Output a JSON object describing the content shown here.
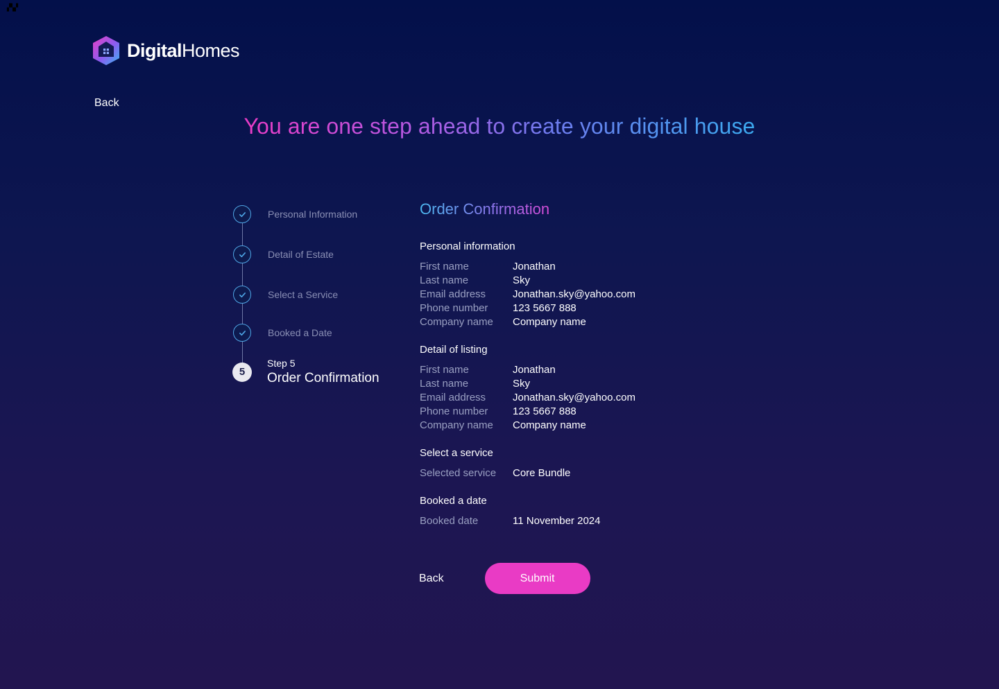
{
  "brand": {
    "name_bold": "Digital",
    "name_light": "Homes"
  },
  "nav": {
    "back_label": "Back"
  },
  "headline": "You are one step ahead to create your digital house",
  "stepper": {
    "completed_steps": [
      "Personal Information",
      "Detail of Estate",
      "Select a Service",
      "Booked a Date"
    ],
    "current": {
      "number": "5",
      "caption": "Step 5",
      "title": "Order Confirmation"
    }
  },
  "summary": {
    "title": "Order Confirmation",
    "personal": {
      "heading": "Personal information",
      "rows": [
        {
          "label": "First name",
          "value": "Jonathan"
        },
        {
          "label": "Last name",
          "value": "Sky"
        },
        {
          "label": "Email address",
          "value": "Jonathan.sky@yahoo.com"
        },
        {
          "label": "Phone number",
          "value": "123 5667 888"
        },
        {
          "label": "Company name",
          "value": "Company name"
        }
      ]
    },
    "listing": {
      "heading": "Detail of listing",
      "rows": [
        {
          "label": "First name",
          "value": "Jonathan"
        },
        {
          "label": "Last name",
          "value": "Sky"
        },
        {
          "label": "Email address",
          "value": "Jonathan.sky@yahoo.com"
        },
        {
          "label": "Phone number",
          "value": "123 5667 888"
        },
        {
          "label": "Company name",
          "value": "Company name"
        }
      ]
    },
    "service": {
      "heading": "Select a service",
      "rows": [
        {
          "label": "Selected service",
          "value": "Core Bundle"
        }
      ]
    },
    "date": {
      "heading": "Booked a date",
      "rows": [
        {
          "label": "Booked date",
          "value": "11 November 2024"
        }
      ]
    }
  },
  "actions": {
    "back_label": "Back",
    "submit_label": "Submit"
  },
  "colors": {
    "accent": "#e93bc5",
    "check": "#4fa6e6",
    "background_top": "#03104a",
    "background_bottom": "#221550"
  }
}
